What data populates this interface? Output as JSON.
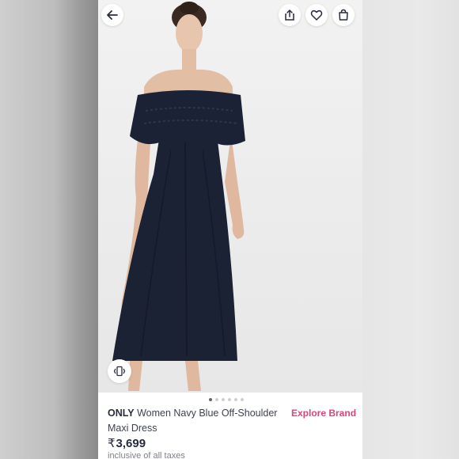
{
  "header": {
    "back_icon": "arrow-left-icon",
    "share_icon": "share-icon",
    "wishlist_icon": "heart-icon",
    "bag_icon": "shopping-bag-icon"
  },
  "gallery": {
    "image_count": 6,
    "active_index": 0,
    "vibration_icon": "phone-vibrate-icon"
  },
  "product": {
    "brand": "ONLY",
    "name": "Women Navy Blue Off-Shoulder",
    "name_line2": "Maxi Dress",
    "explore_brand": "Explore Brand",
    "currency": "₹",
    "price": "3,699",
    "tax_note": "inclusive of all taxes"
  },
  "colors": {
    "accent": "#d6467d",
    "dress": "#1b2234",
    "text_dark": "#282c3f"
  }
}
